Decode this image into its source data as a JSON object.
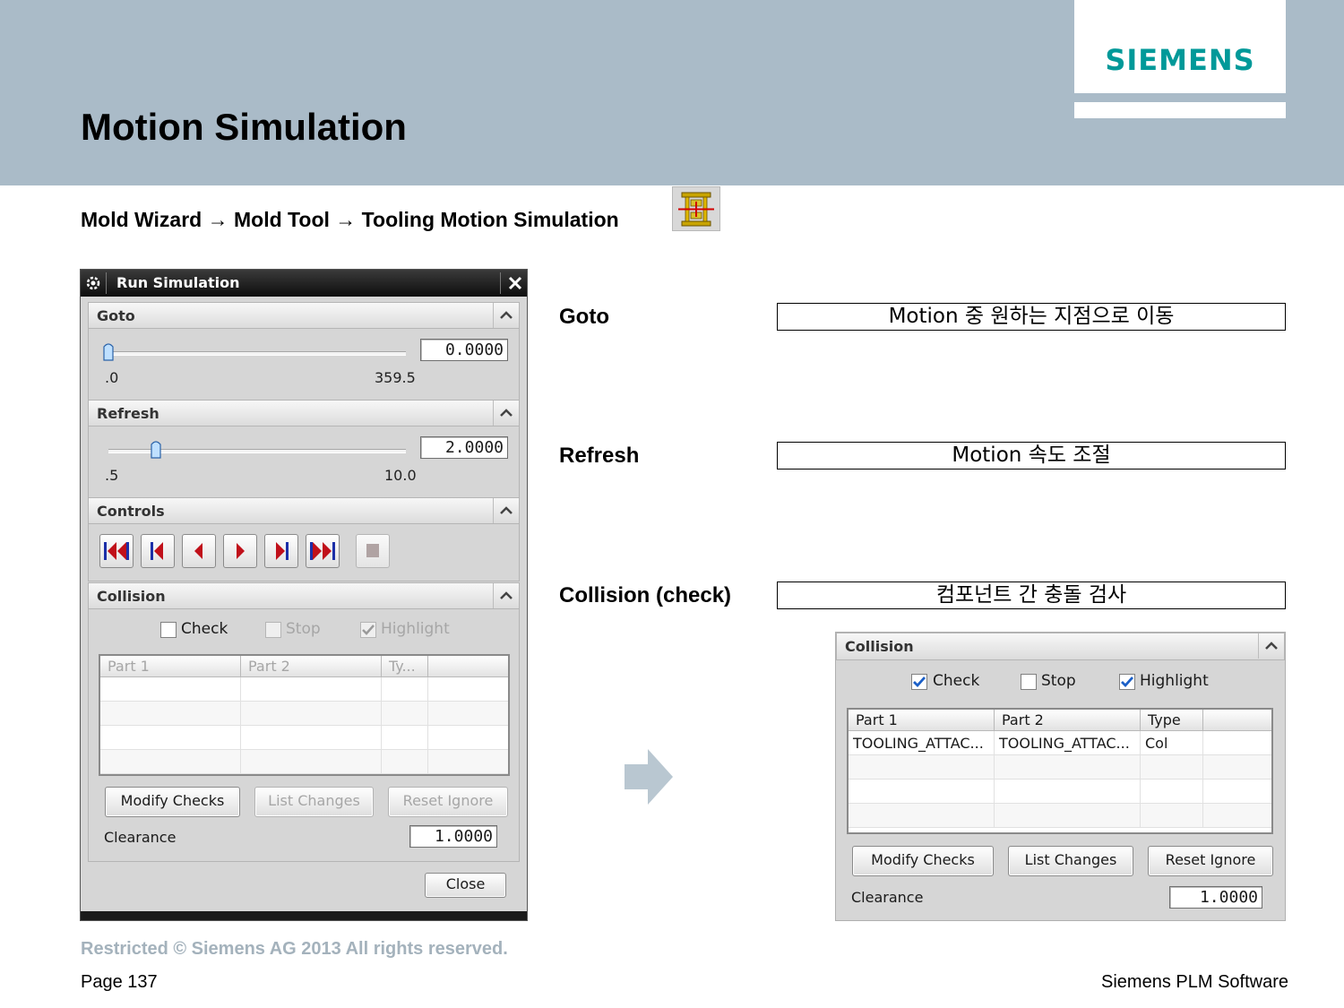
{
  "header": {
    "brand": "SIEMENS",
    "title": "Motion Simulation"
  },
  "breadcrumb": {
    "step1": "Mold Wizard",
    "step2": "Mold Tool",
    "step3": "Tooling Motion Simulation",
    "separator": "→"
  },
  "dialog": {
    "title": "Run Simulation",
    "goto": {
      "label": "Goto",
      "value": "0.0000",
      "min": ".0",
      "max": "359.5",
      "slider_fraction": 0.0
    },
    "refresh": {
      "label": "Refresh",
      "value": "2.0000",
      "min": ".5",
      "max": "10.0",
      "slider_fraction": 0.16
    },
    "controls": {
      "label": "Controls",
      "buttons": [
        "rewind-to-start",
        "step-back",
        "play-backward",
        "play-forward",
        "step-forward",
        "fast-forward-to-end",
        "stop"
      ]
    },
    "collision": {
      "label": "Collision",
      "check_label": "Check",
      "stop_label": "Stop",
      "highlight_label": "Highlight",
      "check_checked": false,
      "stop_checked": false,
      "highlight_checked": true,
      "columns": [
        "Part 1",
        "Part 2",
        "Ty..."
      ],
      "modify_checks": "Modify Checks",
      "list_changes": "List Changes",
      "reset_ignore": "Reset Ignore",
      "clearance_label": "Clearance",
      "clearance_value": "1.0000"
    },
    "close": "Close"
  },
  "explanations": {
    "goto_label": "Goto",
    "goto_desc": "Motion 중 원하는 지점으로 이동",
    "refresh_label": "Refresh",
    "refresh_desc": "Motion 속도 조절",
    "collision_label": "Collision (check)",
    "collision_desc": "컴포넌트 간 충돌 검사"
  },
  "collision_panel": {
    "label": "Collision",
    "check_label": "Check",
    "stop_label": "Stop",
    "highlight_label": "Highlight",
    "check_checked": true,
    "stop_checked": false,
    "highlight_checked": true,
    "columns": [
      "Part 1",
      "Part 2",
      "Type"
    ],
    "rows": [
      [
        "TOOLING_ATTAC...",
        "TOOLING_ATTAC...",
        "Col"
      ]
    ],
    "modify_checks": "Modify Checks",
    "list_changes": "List Changes",
    "reset_ignore": "Reset Ignore",
    "clearance_label": "Clearance",
    "clearance_value": "1.0000"
  },
  "footer": {
    "copyright": "Restricted © Siemens AG 2013 All rights reserved.",
    "page": "Page 137",
    "company": "Siemens PLM Software"
  },
  "colors": {
    "header_band": "#aabbc8",
    "brand": "#009999",
    "footer_gray": "#a4b2bc",
    "arrow": "#b9c7d1"
  }
}
